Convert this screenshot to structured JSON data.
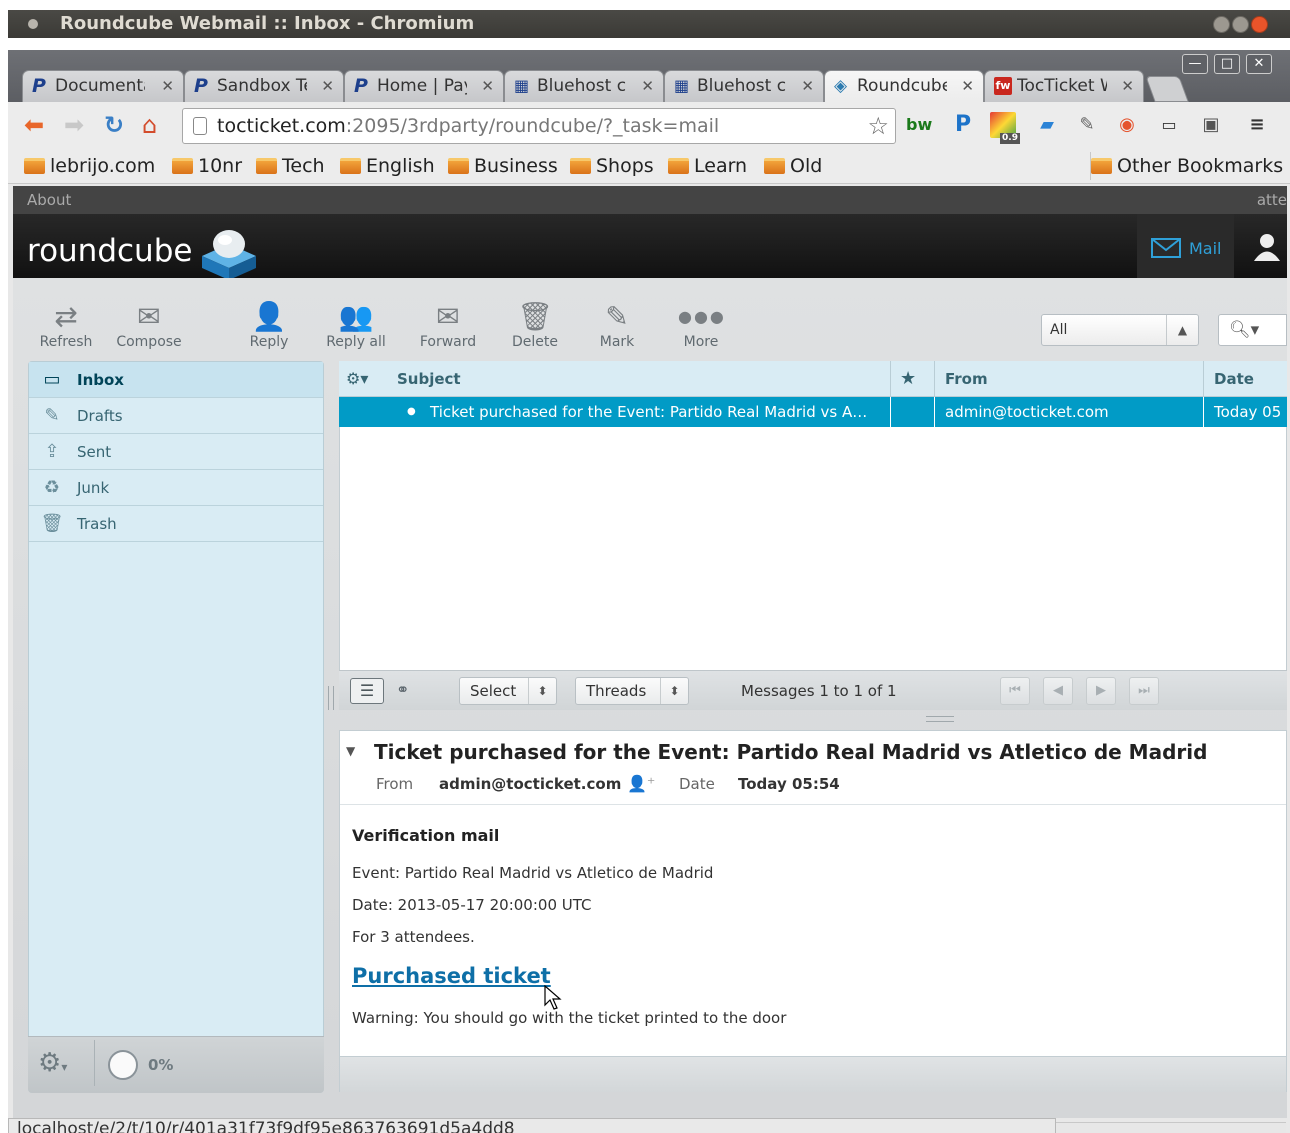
{
  "os_window": {
    "title": "Roundcube Webmail :: Inbox - Chromium"
  },
  "tabs": [
    {
      "label": "Documenta",
      "icon": "paypal-icon"
    },
    {
      "label": "Sandbox Te",
      "icon": "paypal-icon"
    },
    {
      "label": "Home | PayF",
      "icon": "paypal-icon"
    },
    {
      "label": "Bluehost cP",
      "icon": "bluehost-grid-icon"
    },
    {
      "label": "Bluehost cP",
      "icon": "bluehost-grid-icon"
    },
    {
      "label": "Roundcube",
      "icon": "roundcube-icon",
      "active": true
    },
    {
      "label": "TocTicket W",
      "icon": "fw-icon"
    }
  ],
  "address_bar": {
    "host": "tocticket.com",
    "rest": ":2095/3rdparty/roundcube/?_task=mail"
  },
  "bookmarks": [
    "lebrijo.com",
    "10nr",
    "Tech",
    "English",
    "Business",
    "Shops",
    "Learn",
    "Old"
  ],
  "other_bookmarks": "Other Bookmarks",
  "extensions": {
    "bw": "bw",
    "p": "P",
    "badge": "0.9"
  },
  "rc_topbar": {
    "left": "About",
    "right": "atte"
  },
  "rc_header": {
    "logo": "roundcube",
    "mail_tab": "Mail"
  },
  "toolbar": {
    "refresh": "Refresh",
    "compose": "Compose",
    "reply": "Reply",
    "reply_all": "Reply all",
    "forward": "Forward",
    "delete": "Delete",
    "mark": "Mark",
    "more": "More"
  },
  "search": {
    "filter": "All"
  },
  "folders": [
    {
      "label": "Inbox",
      "icon": "inbox-icon",
      "selected": true
    },
    {
      "label": "Drafts",
      "icon": "pencil-icon"
    },
    {
      "label": "Sent",
      "icon": "sent-icon"
    },
    {
      "label": "Junk",
      "icon": "junk-icon"
    },
    {
      "label": "Trash",
      "icon": "trash-icon"
    }
  ],
  "quota": "0%",
  "list": {
    "headers": {
      "subject": "Subject",
      "from": "From",
      "date": "Date"
    },
    "rows": [
      {
        "subject": "Ticket purchased for the Event: Partido Real Madrid vs A…",
        "from": "admin@tocticket.com",
        "date": "Today 05",
        "selected": true
      }
    ]
  },
  "list_footer": {
    "select": "Select",
    "threads": "Threads",
    "count": "Messages 1 to 1 of 1"
  },
  "preview": {
    "subject": "Ticket purchased for the Event: Partido Real Madrid vs Atletico de Madrid",
    "from_label": "From",
    "from_value": "admin@tocticket.com",
    "date_label": "Date",
    "date_value": "Today 05:54",
    "body": {
      "heading": "Verification mail",
      "event": "Event: Partido Real Madrid vs Atletico de Madrid",
      "date": "Date: 2013-05-17 20:00:00 UTC",
      "attendees": "For 3 attendees.",
      "link": "Purchased ticket",
      "warning": "Warning: You should go with the ticket printed to the door"
    }
  },
  "status_bar": "localhost/e/2/t/10/r/401a31f73f9df95e863763691d5a4dd8"
}
